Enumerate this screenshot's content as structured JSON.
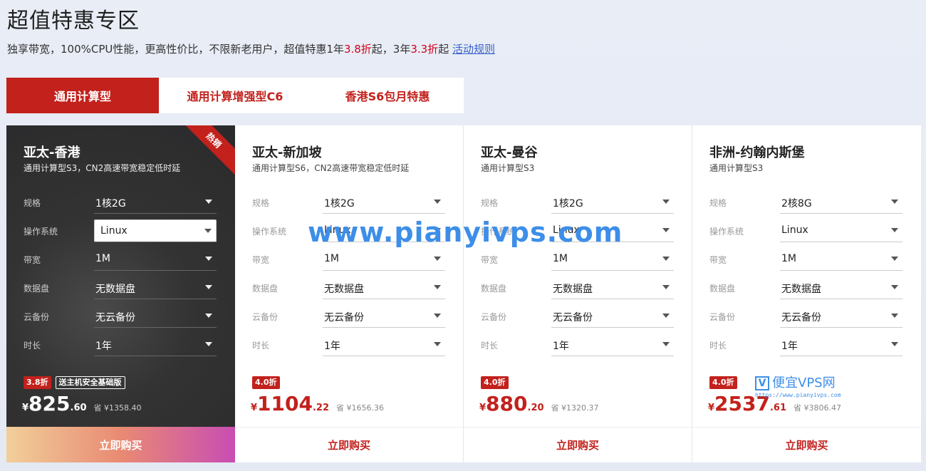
{
  "page": {
    "title": "超值特惠专区",
    "subtitle": {
      "part1": "独享带宽，100%CPU性能，更高性价比，不限新老用户，超值特惠1年",
      "hl1": "3.8折",
      "part2": "起，3年",
      "hl2": "3.3折",
      "part3": "起 ",
      "link": "活动规则"
    }
  },
  "tabs": [
    {
      "label": "通用计算型",
      "active": true
    },
    {
      "label": "通用计算增强型C6",
      "active": false
    },
    {
      "label": "香港S6包月特惠",
      "active": false
    }
  ],
  "cards": [
    {
      "name": "亚太-香港",
      "desc": "通用计算型S3，CN2高速带宽稳定低时延",
      "hot": "热销",
      "rows": [
        {
          "label": "规格",
          "value": "1核2G"
        },
        {
          "label": "操作系统",
          "value": "Linux"
        },
        {
          "label": "带宽",
          "value": "1M"
        },
        {
          "label": "数据盘",
          "value": "无数据盘"
        },
        {
          "label": "云备份",
          "value": "无云备份"
        },
        {
          "label": "时长",
          "value": "1年"
        }
      ],
      "discount": "3.8折",
      "gift": "送主机安全基础版",
      "currency": "¥",
      "price_int": "825",
      "price_dec": ".60",
      "save": "省 ¥1358.40",
      "buy": "立即购买"
    },
    {
      "name": "亚太-新加坡",
      "desc": "通用计算型S6，CN2高速带宽稳定低时延",
      "rows": [
        {
          "label": "规格",
          "value": "1核2G"
        },
        {
          "label": "操作系统",
          "value": "Linux"
        },
        {
          "label": "带宽",
          "value": "1M"
        },
        {
          "label": "数据盘",
          "value": "无数据盘"
        },
        {
          "label": "云备份",
          "value": "无云备份"
        },
        {
          "label": "时长",
          "value": "1年"
        }
      ],
      "discount": "4.0折",
      "currency": "¥",
      "price_int": "1104",
      "price_dec": ".22",
      "save": "省 ¥1656.36",
      "buy": "立即购买"
    },
    {
      "name": "亚太-曼谷",
      "desc": "通用计算型S3",
      "rows": [
        {
          "label": "规格",
          "value": "1核2G"
        },
        {
          "label": "操作系统",
          "value": "Linux"
        },
        {
          "label": "带宽",
          "value": "1M"
        },
        {
          "label": "数据盘",
          "value": "无数据盘"
        },
        {
          "label": "云备份",
          "value": "无云备份"
        },
        {
          "label": "时长",
          "value": "1年"
        }
      ],
      "discount": "4.0折",
      "currency": "¥",
      "price_int": "880",
      "price_dec": ".20",
      "save": "省 ¥1320.37",
      "buy": "立即购买"
    },
    {
      "name": "非洲-约翰内斯堡",
      "desc": "通用计算型S3",
      "rows": [
        {
          "label": "规格",
          "value": "2核8G"
        },
        {
          "label": "操作系统",
          "value": "Linux"
        },
        {
          "label": "带宽",
          "value": "1M"
        },
        {
          "label": "数据盘",
          "value": "无数据盘"
        },
        {
          "label": "云备份",
          "value": "无云备份"
        },
        {
          "label": "时长",
          "value": "1年"
        }
      ],
      "discount": "4.0折",
      "currency": "¥",
      "price_int": "2537",
      "price_dec": ".61",
      "save": "省 ¥3806.47",
      "buy": "立即购买"
    }
  ],
  "watermark": {
    "text": "www.pianyivps.com",
    "logo_v": "V",
    "logo_text": "便宜VPS网",
    "logo_url": "https://www.pianyivps.com"
  },
  "colors": {
    "brand": "#c2211c",
    "watermark": "#3d8ee8"
  }
}
